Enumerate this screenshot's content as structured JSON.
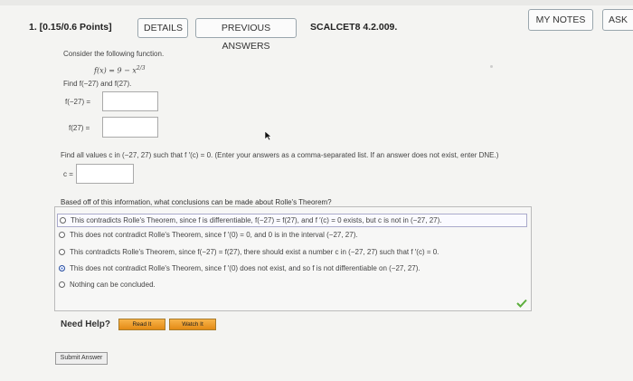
{
  "header": {
    "question_number": "1. [0.15/0.6 Points]",
    "details_label": "DETAILS",
    "previous_answers_label": "PREVIOUS ANSWERS",
    "problem_code": "SCALCET8 4.2.009.",
    "my_notes_label": "MY NOTES",
    "ask_label": "ASK"
  },
  "problem": {
    "intro": "Consider the following function.",
    "function": "f(x) = 9 − x",
    "exponent": "2/3",
    "find": "Find f(−27) and f(27).",
    "label_neg27": "f(−27) =",
    "label_27": "f(27) =",
    "values_prompt": "Find all values c in (−27, 27) such that f ′(c) = 0. (Enter your answers as a comma-separated list. If an answer does not exist, enter DNE.)",
    "c_label": "c =",
    "answer_f_neg27": "",
    "answer_f_27": "",
    "answer_c": ""
  },
  "rolle": {
    "question": "Based off of this information, what conclusions can be made about Rolle's Theorem?",
    "options": [
      {
        "text": "This contradicts Rolle's Theorem, since f is differentiable, f(−27) = f(27), and f ′(c) = 0 exists, but c is not in (−27, 27).",
        "selected": false
      },
      {
        "text": "This does not contradict Rolle's Theorem, since f ′(0) = 0, and 0 is in the interval (−27, 27).",
        "selected": false
      },
      {
        "text": "This contradicts Rolle's Theorem, since f(−27) = f(27), there should exist a number c in (−27, 27) such that f ′(c) = 0.",
        "selected": false
      },
      {
        "text": "This does not contradict Rolle's Theorem, since f ′(0) does not exist, and so f is not differentiable on (−27, 27).",
        "selected": true
      },
      {
        "text": "Nothing can be concluded.",
        "selected": false
      }
    ]
  },
  "help": {
    "need_help": "Need Help?",
    "read_it": "Read It",
    "watch_it": "Watch It"
  },
  "submit_label": "Submit Answer",
  "colors": {
    "accent_check": "#5cae3c",
    "radio_selected": "#3b6bd3",
    "help_button": "#f0a030"
  }
}
